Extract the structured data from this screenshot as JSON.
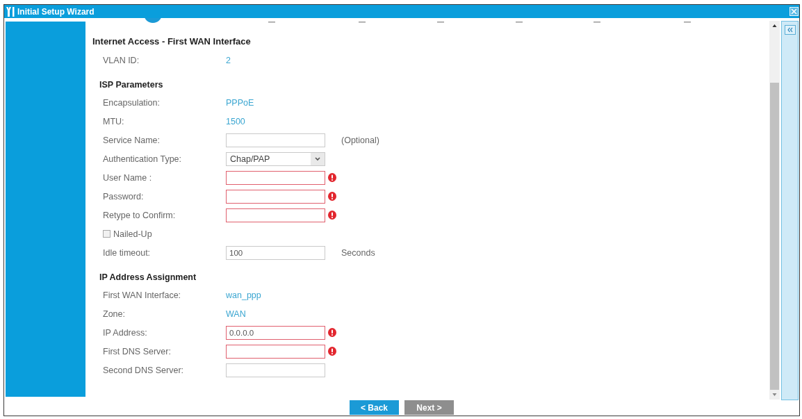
{
  "window": {
    "title": "Initial Setup Wizard"
  },
  "heading": "Internet Access - First WAN Interface",
  "sections": [
    {
      "rows": [
        {
          "kind": "info",
          "label": "VLAN ID:",
          "value": "2"
        }
      ]
    },
    {
      "title": "ISP Parameters",
      "rows": [
        {
          "kind": "info",
          "label": "Encapsulation:",
          "value": "PPPoE"
        },
        {
          "kind": "info",
          "label": "MTU:",
          "value": "1500"
        },
        {
          "kind": "text",
          "label": "Service Name:",
          "invalid": false,
          "note": "(Optional)"
        },
        {
          "kind": "select",
          "label": "Authentication Type:",
          "value": "Chap/PAP"
        },
        {
          "kind": "text",
          "label": "User Name :",
          "invalid": true
        },
        {
          "kind": "text",
          "label": "Password:",
          "invalid": true
        },
        {
          "kind": "text",
          "label": "Retype to Confirm:",
          "invalid": true
        },
        {
          "kind": "checkbox",
          "label": "Nailed-Up",
          "checked": false
        },
        {
          "kind": "text",
          "label": "Idle timeout:",
          "value": "100",
          "invalid": false,
          "note": "Seconds"
        }
      ]
    },
    {
      "title": "IP Address Assignment",
      "rows": [
        {
          "kind": "info",
          "label": "First WAN Interface:",
          "value": "wan_ppp"
        },
        {
          "kind": "info",
          "label": "Zone:",
          "value": "WAN"
        },
        {
          "kind": "text",
          "label": "IP Address:",
          "value": "0.0.0.0",
          "invalid": true
        },
        {
          "kind": "text",
          "label": "First DNS Server:",
          "invalid": true
        },
        {
          "kind": "text",
          "label": "Second DNS Server:",
          "invalid": false
        }
      ]
    }
  ],
  "buttons": [
    {
      "label": "< Back",
      "disabled": false
    },
    {
      "label": "Next >",
      "disabled": true
    }
  ]
}
